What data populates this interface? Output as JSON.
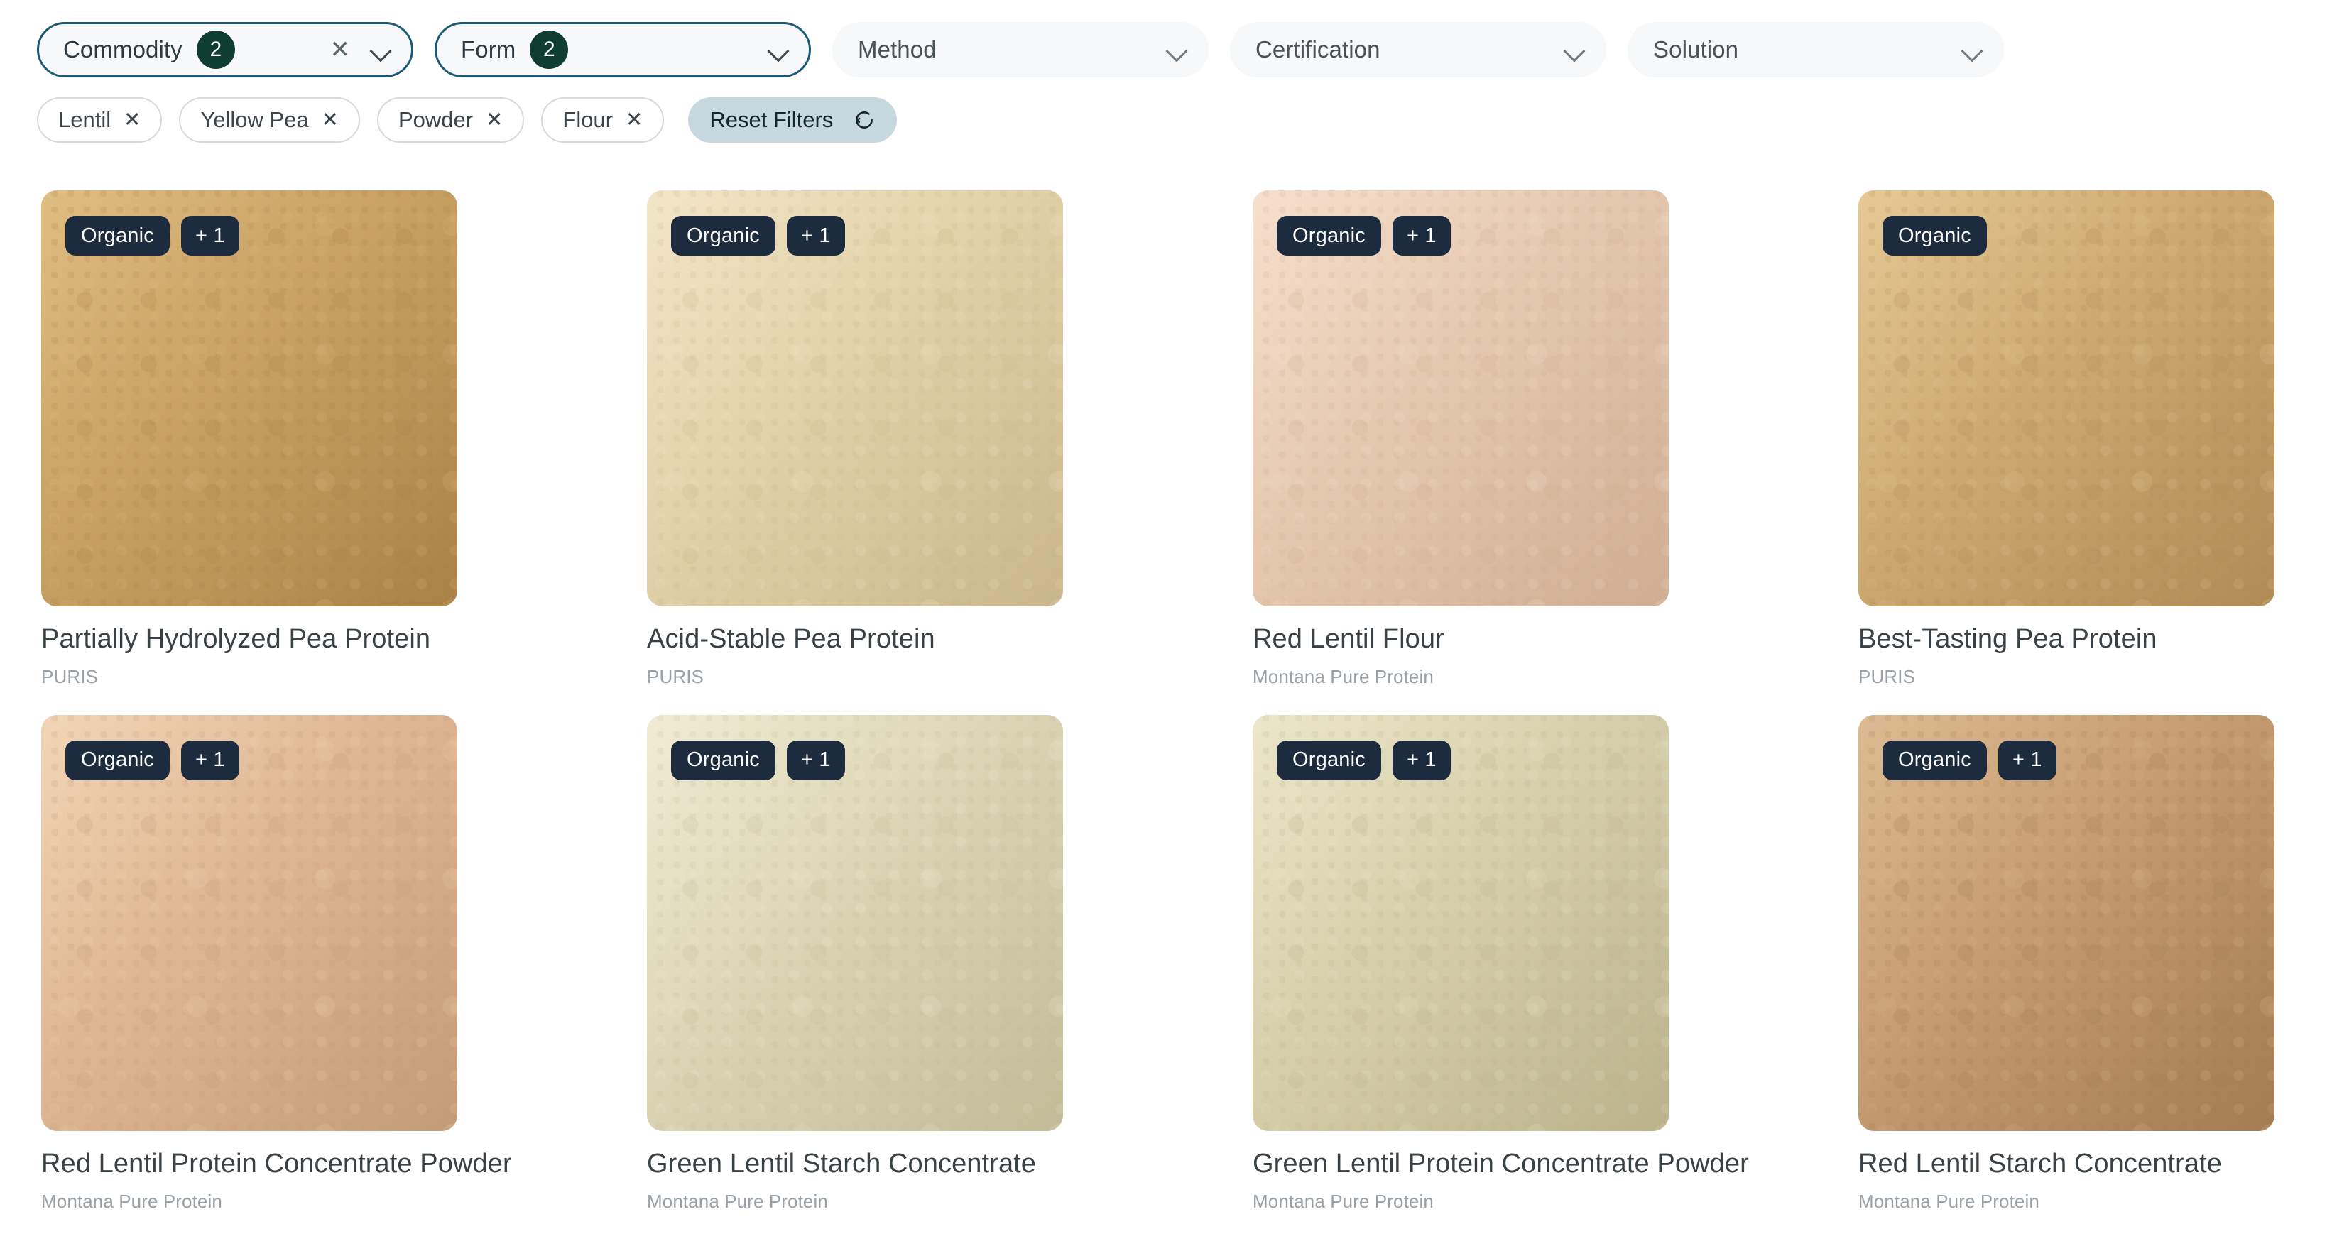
{
  "filters": {
    "selects": [
      {
        "label": "Commodity",
        "count": "2",
        "active": true,
        "clearable": true,
        "icon": "chevron-down-icon",
        "clear_icon": "close-icon"
      },
      {
        "label": "Form",
        "count": "2",
        "active": true,
        "clearable": false,
        "icon": "chevron-down-icon"
      },
      {
        "label": "Method",
        "count": "",
        "active": false,
        "clearable": false,
        "icon": "chevron-down-icon"
      },
      {
        "label": "Certification",
        "count": "",
        "active": false,
        "clearable": false,
        "icon": "chevron-down-icon"
      },
      {
        "label": "Solution",
        "count": "",
        "active": false,
        "clearable": false,
        "icon": "chevron-down-icon"
      }
    ],
    "chips": [
      {
        "label": "Lentil",
        "remove_icon": "×"
      },
      {
        "label": "Yellow Pea",
        "remove_icon": "×"
      },
      {
        "label": "Powder",
        "remove_icon": "×"
      },
      {
        "label": "Flour",
        "remove_icon": "×"
      }
    ],
    "reset": {
      "label": "Reset Filters",
      "icon": "refresh-icon"
    }
  },
  "colors": {
    "accent_badge_count": "#0f3d31",
    "active_select_border": "#1c5878",
    "badge_bg": "#1c2b3e",
    "reset_bg": "#c7d8df",
    "title_text": "#3a4145",
    "subtitle_text": "#9aa1a6"
  },
  "products": [
    {
      "title": "Partially Hydrolyzed Pea Protein",
      "supplier": "PURIS",
      "badges": [
        "Organic",
        "+ 1"
      ],
      "swatch": {
        "base": "#c9a264",
        "dark": "#a98248",
        "light": "#e0bd82"
      }
    },
    {
      "title": "Acid-Stable Pea Protein",
      "supplier": "PURIS",
      "badges": [
        "Organic",
        "+ 1"
      ],
      "swatch": {
        "base": "#e3d2aa",
        "dark": "#c9b68c",
        "light": "#f3e6c8"
      }
    },
    {
      "title": "Red Lentil Flour",
      "supplier": "Montana Pure Protein",
      "badges": [
        "Organic",
        "+ 1"
      ],
      "swatch": {
        "base": "#e6c9b0",
        "dark": "#cfad92",
        "light": "#f6e0cd"
      }
    },
    {
      "title": "Best-Tasting Pea Protein",
      "supplier": "PURIS",
      "badges": [
        "Organic"
      ],
      "swatch": {
        "base": "#ceab72",
        "dark": "#b08b55",
        "light": "#e6c994"
      }
    },
    {
      "title": "Red Lentil Protein Concentrate Powder",
      "supplier": "Montana Pure Protein",
      "badges": [
        "Organic",
        "+ 1"
      ],
      "swatch": {
        "base": "#dfb793",
        "dark": "#c29b78",
        "light": "#f2d6b7"
      }
    },
    {
      "title": "Green Lentil Starch Concentrate",
      "supplier": "Montana Pure Protein",
      "badges": [
        "Organic",
        "+ 1"
      ],
      "swatch": {
        "base": "#ddd6b6",
        "dark": "#c2bb98",
        "light": "#f0ecd4"
      }
    },
    {
      "title": "Green Lentil Protein Concentrate Powder",
      "supplier": "Montana Pure Protein",
      "badges": [
        "Organic",
        "+ 1"
      ],
      "swatch": {
        "base": "#d7d0ac",
        "dark": "#b9b28b",
        "light": "#ece7ca"
      }
    },
    {
      "title": "Red Lentil Starch Concentrate",
      "supplier": "Montana Pure Protein",
      "badges": [
        "Organic",
        "+ 1"
      ],
      "swatch": {
        "base": "#c79d72",
        "dark": "#a37c53",
        "light": "#ddbb92"
      }
    }
  ]
}
